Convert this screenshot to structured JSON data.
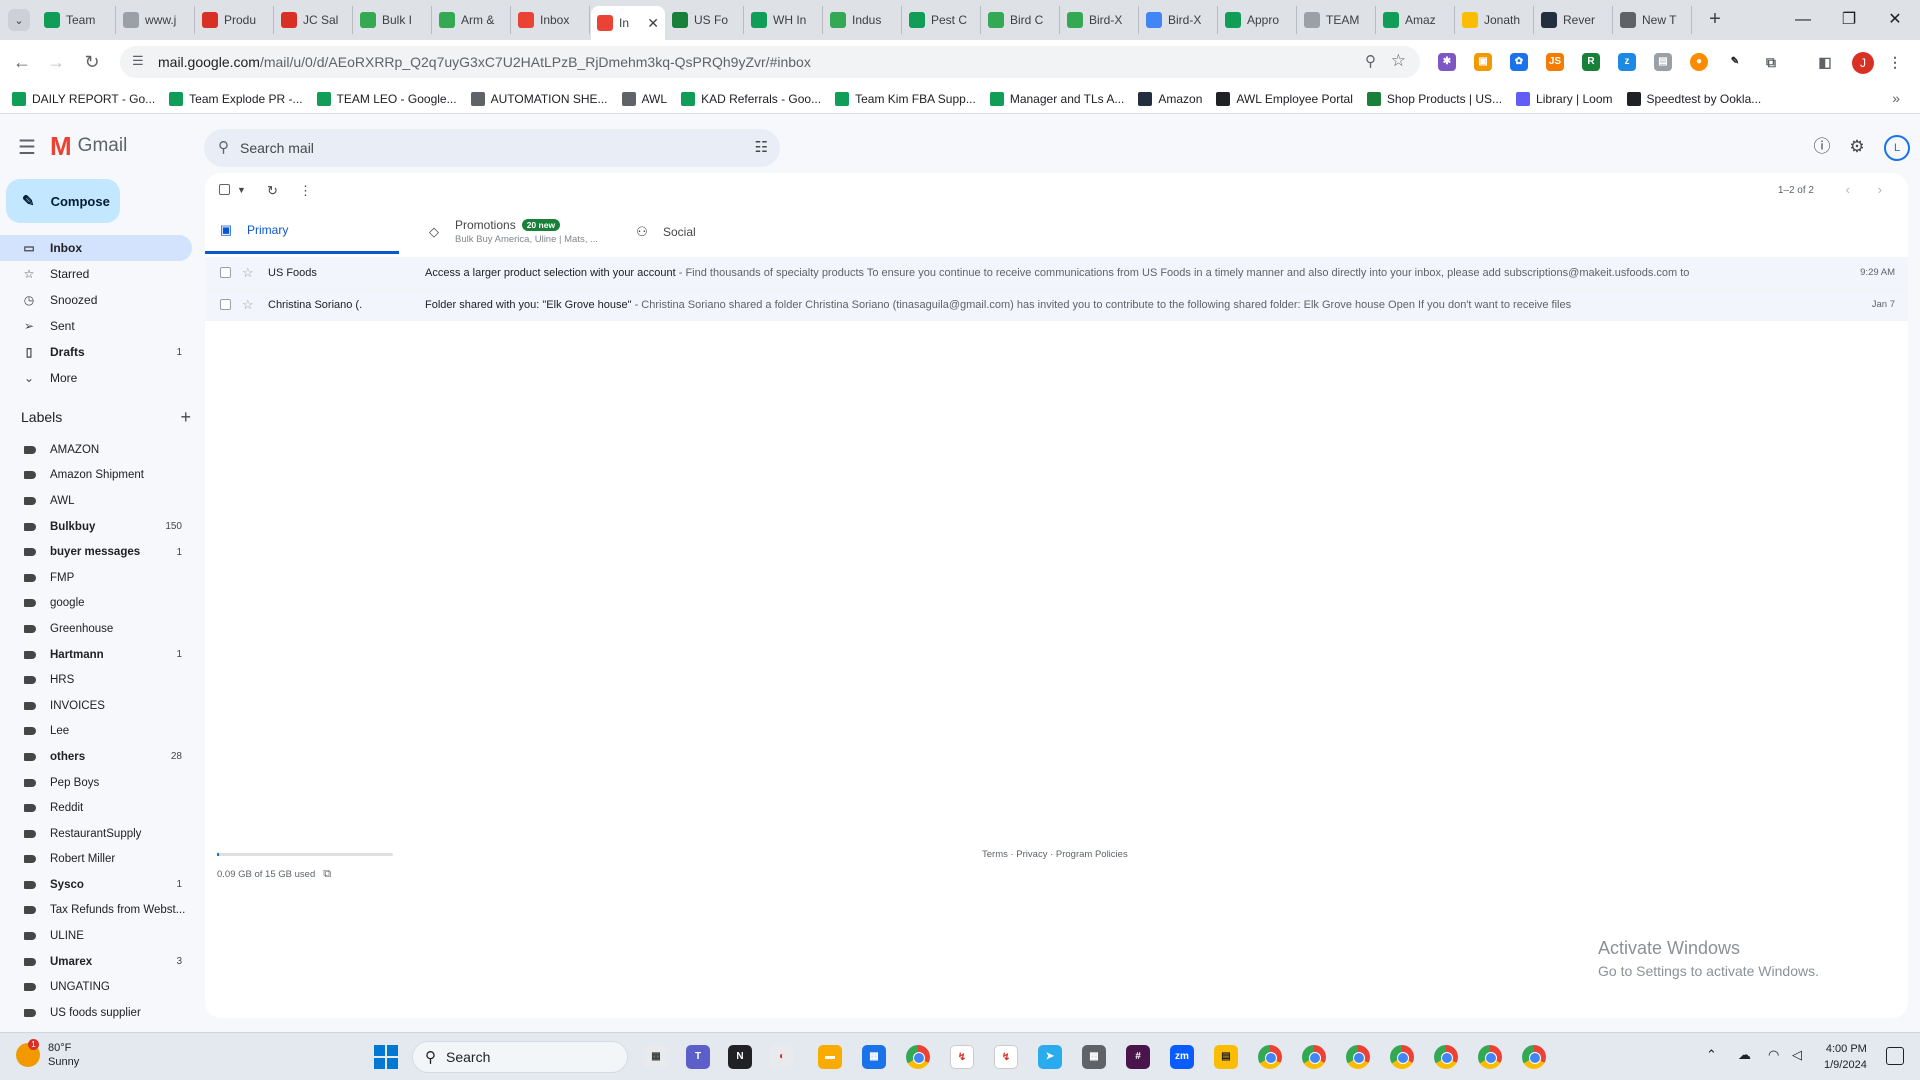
{
  "browser": {
    "tabs": [
      {
        "title": "Team",
        "icon": "sheets-icon",
        "color": "#0f9d58"
      },
      {
        "title": "www.j",
        "icon": "generic-icon",
        "color": "#9aa0a6"
      },
      {
        "title": "Produ",
        "icon": "jc-icon",
        "color": "#d93025"
      },
      {
        "title": "JC Sal",
        "icon": "jc-icon",
        "color": "#d93025"
      },
      {
        "title": "Bulk I",
        "icon": "w-icon",
        "color": "#34a853"
      },
      {
        "title": "Arm &",
        "icon": "w-icon",
        "color": "#34a853"
      },
      {
        "title": "Inbox",
        "icon": "gmail-icon",
        "color": "#ea4335"
      },
      {
        "title": "In",
        "icon": "gmail-icon",
        "color": "#ea4335",
        "active": true
      },
      {
        "title": "US Fo",
        "icon": "usfoods-icon",
        "color": "#188038"
      },
      {
        "title": "WH In",
        "icon": "sheets-icon",
        "color": "#0f9d58"
      },
      {
        "title": "Indus",
        "icon": "w-icon",
        "color": "#34a853"
      },
      {
        "title": "Pest C",
        "icon": "sheets-icon",
        "color": "#0f9d58"
      },
      {
        "title": "Bird C",
        "icon": "w-icon",
        "color": "#34a853"
      },
      {
        "title": "Bird-X",
        "icon": "w-icon",
        "color": "#34a853"
      },
      {
        "title": "Bird-X",
        "icon": "google-icon",
        "color": "#4285f4"
      },
      {
        "title": "Appro",
        "icon": "sheets-icon",
        "color": "#0f9d58"
      },
      {
        "title": "TEAM",
        "icon": "generic-icon",
        "color": "#9aa0a6"
      },
      {
        "title": "Amaz",
        "icon": "sheets-icon",
        "color": "#0f9d58"
      },
      {
        "title": "Jonath",
        "icon": "drive-icon",
        "color": "#fbbc04"
      },
      {
        "title": "Rever",
        "icon": "amazon-icon",
        "color": "#232f3e"
      },
      {
        "title": "New T",
        "icon": "chrome-icon",
        "color": "#5f6368"
      }
    ],
    "url_main": "mail.google.com",
    "url_rest": "/mail/u/0/d/AEoRXRRp_Q2q7uyG3xC7U2HAtLPzB_RjDmehm3kq-QsPRQh9yZvr/#inbox",
    "profile_initial": "J",
    "bookmarks": [
      {
        "label": "DAILY REPORT - Go...",
        "icon": "sheets-icon",
        "color": "#0f9d58"
      },
      {
        "label": "Team Explode PR -...",
        "icon": "sheets-icon",
        "color": "#0f9d58"
      },
      {
        "label": "TEAM LEO - Google...",
        "icon": "sheets-icon",
        "color": "#0f9d58"
      },
      {
        "label": "AUTOMATION SHE...",
        "icon": "folder-icon",
        "color": "#5f6368"
      },
      {
        "label": "AWL",
        "icon": "folder-icon",
        "color": "#5f6368"
      },
      {
        "label": "KAD Referrals - Goo...",
        "icon": "sheets-icon",
        "color": "#0f9d58"
      },
      {
        "label": "Team Kim FBA Supp...",
        "icon": "sheets-icon",
        "color": "#0f9d58"
      },
      {
        "label": "Manager and TLs A...",
        "icon": "sheets-icon",
        "color": "#0f9d58"
      },
      {
        "label": "Amazon",
        "icon": "amazon-icon",
        "color": "#232f3e"
      },
      {
        "label": "AWL Employee Portal",
        "icon": "portal-icon",
        "color": "#202124"
      },
      {
        "label": "Shop Products | US...",
        "icon": "usfoods-icon",
        "color": "#188038"
      },
      {
        "label": "Library | Loom",
        "icon": "loom-icon",
        "color": "#625df5"
      },
      {
        "label": "Speedtest by Ookla...",
        "icon": "speedtest-icon",
        "color": "#202124"
      }
    ]
  },
  "gmail": {
    "logo_text": "Gmail",
    "search_placeholder": "Search mail",
    "account_initial": "L",
    "compose_label": "Compose",
    "nav": [
      {
        "label": "Inbox",
        "icon": "inbox-icon",
        "count": "",
        "active": true,
        "bold": true
      },
      {
        "label": "Starred",
        "icon": "star-icon",
        "count": ""
      },
      {
        "label": "Snoozed",
        "icon": "clock-icon",
        "count": ""
      },
      {
        "label": "Sent",
        "icon": "send-icon",
        "count": ""
      },
      {
        "label": "Drafts",
        "icon": "draft-icon",
        "count": "1",
        "bold": true
      },
      {
        "label": "More",
        "icon": "chevron-down-icon",
        "count": ""
      }
    ],
    "labels_title": "Labels",
    "labels": [
      {
        "name": "AMAZON",
        "count": ""
      },
      {
        "name": "Amazon Shipment",
        "count": ""
      },
      {
        "name": "AWL",
        "count": ""
      },
      {
        "name": "Bulkbuy",
        "count": "150",
        "bold": true
      },
      {
        "name": "buyer messages",
        "count": "1",
        "bold": true
      },
      {
        "name": "FMP",
        "count": ""
      },
      {
        "name": "google",
        "count": ""
      },
      {
        "name": "Greenhouse",
        "count": ""
      },
      {
        "name": "Hartmann",
        "count": "1",
        "bold": true
      },
      {
        "name": "HRS",
        "count": ""
      },
      {
        "name": "INVOICES",
        "count": ""
      },
      {
        "name": "Lee",
        "count": ""
      },
      {
        "name": "others",
        "count": "28",
        "bold": true
      },
      {
        "name": "Pep Boys",
        "count": ""
      },
      {
        "name": "Reddit",
        "count": ""
      },
      {
        "name": "RestaurantSupply",
        "count": ""
      },
      {
        "name": "Robert Miller",
        "count": ""
      },
      {
        "name": "Sysco",
        "count": "1",
        "bold": true
      },
      {
        "name": "Tax Refunds from Webst...",
        "count": ""
      },
      {
        "name": "ULINE",
        "count": ""
      },
      {
        "name": "Umarex",
        "count": "3",
        "bold": true
      },
      {
        "name": "UNGATING",
        "count": ""
      },
      {
        "name": "US foods supplier",
        "count": ""
      }
    ],
    "pager": "1–2 of 2",
    "tabs": {
      "primary": "Primary",
      "promotions": "Promotions",
      "promotions_badge": "20 new",
      "promotions_sub": "Bulk Buy America, Uline | Mats, ...",
      "social": "Social"
    },
    "emails": [
      {
        "sender": "US Foods",
        "subject": "Access a larger product selection with your account",
        "snippet": " - Find thousands of specialty products To ensure you continue to receive communications from US Foods in a timely manner and also directly into your inbox, please add subscriptions@makeit.usfoods.com to",
        "date": "9:29 AM"
      },
      {
        "sender": "Christina Soriano (.",
        "subject": "Folder shared with you: \"Elk Grove house\"",
        "snippet": " - Christina Soriano shared a folder Christina Soriano (tinasaguila@gmail.com) has invited you to contribute to the following shared folder: Elk Grove house Open If you don't want to receive files",
        "date": "Jan 7"
      }
    ],
    "storage_text": "0.09 GB of 15 GB used",
    "storage_fraction": 0.006,
    "footer_links": "Terms · Privacy · Program Policies"
  },
  "watermark": {
    "line1": "Activate Windows",
    "line2": "Go to Settings to activate Windows."
  },
  "taskbar": {
    "weather_temp": "80°F",
    "weather_desc": "Sunny",
    "weather_badge": "1",
    "search_label": "Search",
    "time": "4:00 PM",
    "date": "1/9/2024"
  }
}
